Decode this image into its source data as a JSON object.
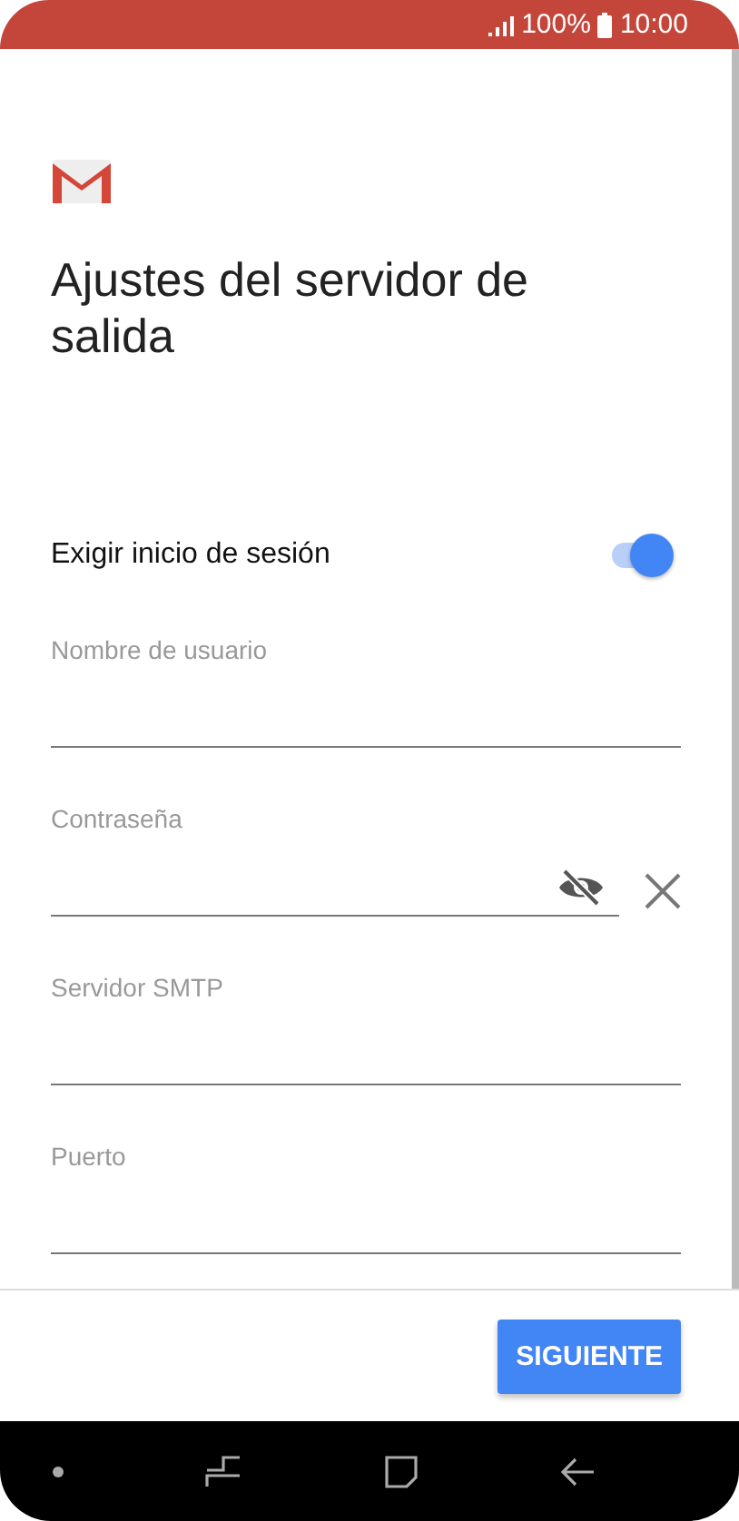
{
  "status_bar": {
    "battery": "100%",
    "time": "10:00"
  },
  "title": "Ajustes del servidor de salida",
  "require_login": {
    "label": "Exigir inicio de sesión",
    "on": true
  },
  "fields": [
    {
      "kind": "text",
      "placeholder": "Nombre de usuario"
    },
    {
      "kind": "password",
      "placeholder": "Contraseña"
    },
    {
      "kind": "text",
      "placeholder": "Servidor SMTP"
    },
    {
      "kind": "text",
      "placeholder": "Puerto"
    }
  ],
  "buttons": [
    "SIGUIENTE"
  ]
}
